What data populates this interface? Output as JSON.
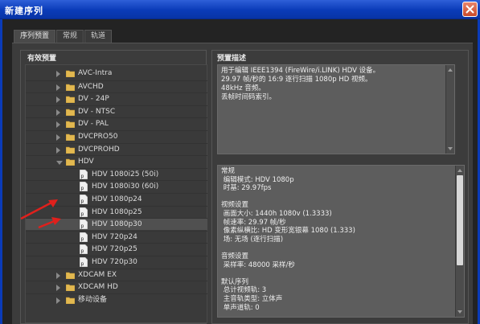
{
  "window": {
    "title": "新建序列"
  },
  "tabs": [
    {
      "label": "序列预置",
      "active": true
    },
    {
      "label": "常规",
      "active": false
    },
    {
      "label": "轨道",
      "active": false
    }
  ],
  "presets_group": {
    "title": "有效预置",
    "items": [
      {
        "label": "AVC-Intra",
        "type": "folder"
      },
      {
        "label": "AVCHD",
        "type": "folder"
      },
      {
        "label": "DV - 24P",
        "type": "folder"
      },
      {
        "label": "DV - NTSC",
        "type": "folder"
      },
      {
        "label": "DV - PAL",
        "type": "folder"
      },
      {
        "label": "DVCPRO50",
        "type": "folder"
      },
      {
        "label": "DVCPROHD",
        "type": "folder"
      },
      {
        "label": "HDV",
        "type": "folder-open"
      },
      {
        "label": "HDV 1080i25 (50i)",
        "type": "file"
      },
      {
        "label": "HDV 1080i30 (60i)",
        "type": "file"
      },
      {
        "label": "HDV 1080p24",
        "type": "file"
      },
      {
        "label": "HDV 1080p25",
        "type": "file"
      },
      {
        "label": "HDV 1080p30",
        "type": "file",
        "selected": true
      },
      {
        "label": "HDV 720p24",
        "type": "file"
      },
      {
        "label": "HDV 720p25",
        "type": "file"
      },
      {
        "label": "HDV 720p30",
        "type": "file"
      },
      {
        "label": "XDCAM EX",
        "type": "folder"
      },
      {
        "label": "XDCAM HD",
        "type": "folder"
      },
      {
        "label": "移动设备",
        "type": "folder"
      }
    ]
  },
  "description_group": {
    "title": "预置描述",
    "description": [
      "用于编辑 IEEE1394 (FireWire/i.LINK) HDV 设备。",
      "29.97 帧/秒的 16:9 逐行扫描 1080p HD 视频。",
      "48kHz 音频。",
      "丢帧时间码索引。"
    ],
    "details": [
      "常规",
      " 编辑模式: HDV 1080p",
      " 时基: 29.97fps",
      "",
      "视频设置",
      " 画面大小: 1440h 1080v (1.3333)",
      " 帧速率: 29.97 帧/秒",
      " 像素纵横比: HD 变形宽银幕 1080 (1.333)",
      " 场: 无场 (逐行扫描)",
      "",
      "音频设置",
      " 采样率: 48000 采样/秒",
      "",
      "默认序列",
      " 总计视频轨: 3",
      " 主音轨类型: 立体声",
      " 单声道轨: 0"
    ]
  },
  "colors": {
    "titlebar": "#0a3bb8",
    "annotation_arrow": "#e0201c"
  }
}
